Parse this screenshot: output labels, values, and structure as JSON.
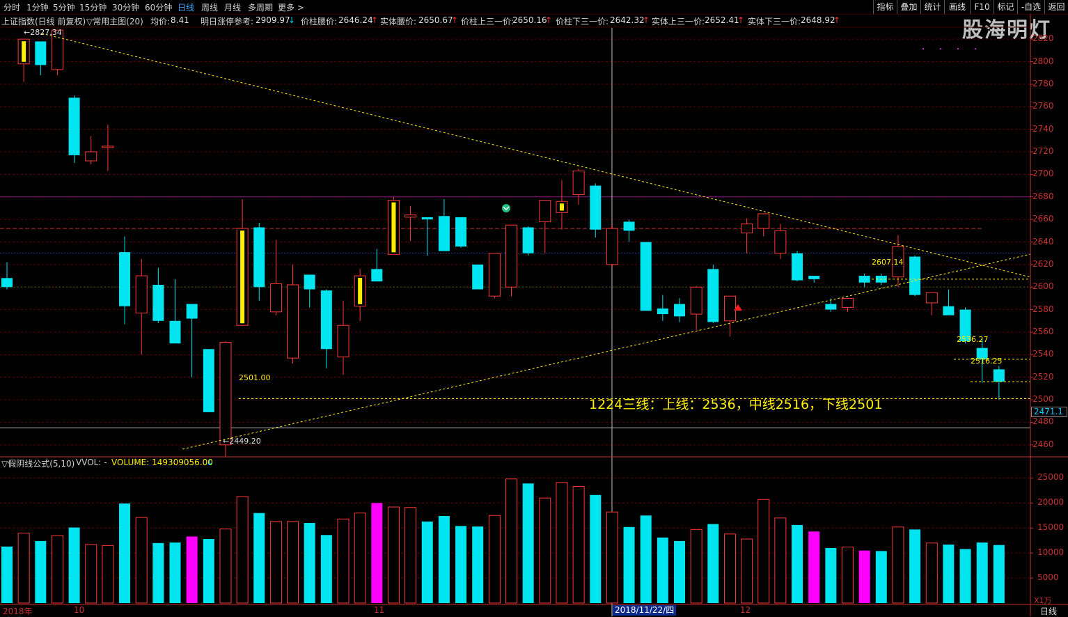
{
  "toolbar": {
    "periods": [
      "分时",
      "1分钟",
      "5分钟",
      "15分钟",
      "30分钟",
      "60分钟",
      "日线",
      "周线",
      "月线",
      "多周期",
      "更多 >"
    ],
    "active_period": "日线",
    "right_tools": [
      "指标",
      "叠加",
      "统计",
      "画线",
      "F10",
      "标记",
      "-自选",
      "返回"
    ]
  },
  "info": {
    "index_name": "上证指数(日线 前复权)",
    "main_chart": "▽常用主图(20)",
    "avg_label": "均价:",
    "avg_value": "8.41",
    "limit_label": "明日涨停参考:",
    "limit_value": "2909.97",
    "limit_arrow": "↓",
    "waist_label": "价柱腰价:",
    "waist_value": "2646.24",
    "waist_arrow": "↑",
    "body_waist_label": "实体腰价:",
    "body_waist_value": "2650.67",
    "body_waist_arrow": "↑",
    "upper_third_label": "价柱上三一价:",
    "upper_third_value": "2650.16",
    "upper_third_arrow": "↑",
    "lower_third_label": "价柱下三一价:",
    "lower_third_value": "2642.32",
    "lower_third_arrow": "↑",
    "body_upper_label": "实体上三一价:",
    "body_upper_value": "2652.41",
    "body_upper_arrow": "↑",
    "body_lower_label": "实体下三一价:",
    "body_lower_value": "2648.92",
    "body_lower_arrow": "↑"
  },
  "logo": "股海明灯",
  "volume_bar": {
    "indicator": "▽假阴线公式(5,10)",
    "vol_label": "VVOL: -",
    "volume_text": "VOLUME: 149309056.00",
    "volume_arrow": "↓"
  },
  "price_axis": [
    "2820",
    "2800",
    "2780",
    "2760",
    "2740",
    "2720",
    "2700",
    "2680",
    "2660",
    "2640",
    "2620",
    "2600",
    "2580",
    "2560",
    "2540",
    "2520",
    "2500",
    "2480",
    "2460"
  ],
  "current_price": "2471.1",
  "volume_axis": [
    "25000",
    "20000",
    "15000",
    "10000",
    "5000"
  ],
  "volume_unit": "X1万",
  "dates": {
    "year": "2018年",
    "m10": "10",
    "m11": "11",
    "m12": "12",
    "selected": "2018/11/22/四"
  },
  "bottom_right_period": "日线",
  "annotations": {
    "high": "2827.34",
    "low": "2449.20",
    "level_2501": "2501.00",
    "level_2607": "2607.14",
    "level_2536": "2536.27",
    "level_2516": "2516.25",
    "note": "1224三线：上线：2536，中线2516，下线2501"
  },
  "chart_data": {
    "type": "candlestick",
    "price_ylim": [
      2450,
      2830
    ],
    "volume_ylim": [
      0,
      27000
    ],
    "candles": [
      {
        "o": 2608,
        "h": 2622,
        "l": 2598,
        "c": 2600,
        "v": 11300,
        "t": "down"
      },
      {
        "o": 2798,
        "h": 2812,
        "l": 2782,
        "c": 2820,
        "v": 14000,
        "t": "up"
      },
      {
        "o": 2797,
        "h": 2812,
        "l": 2788,
        "c": 2818,
        "v": 12400,
        "t": "down"
      },
      {
        "o": 2793,
        "h": 2827,
        "l": 2788,
        "c": 2828,
        "v": 13500,
        "t": "up"
      },
      {
        "o": 2768,
        "h": 2770,
        "l": 2710,
        "c": 2717,
        "v": 15100,
        "t": "down"
      },
      {
        "o": 2712,
        "h": 2734,
        "l": 2709,
        "c": 2720,
        "v": 11700,
        "t": "up"
      },
      {
        "o": 2724,
        "h": 2744,
        "l": 2703,
        "c": 2725,
        "v": 11500,
        "t": "up"
      },
      {
        "o": 2631,
        "h": 2645,
        "l": 2567,
        "c": 2583,
        "v": 19900,
        "t": "down"
      },
      {
        "o": 2577,
        "h": 2625,
        "l": 2540,
        "c": 2610,
        "v": 17100,
        "t": "up"
      },
      {
        "o": 2602,
        "h": 2617,
        "l": 2568,
        "c": 2570,
        "v": 12000,
        "t": "down"
      },
      {
        "o": 2570,
        "h": 2607,
        "l": 2560,
        "c": 2550,
        "v": 12100,
        "t": "down"
      },
      {
        "o": 2572,
        "h": 2580,
        "l": 2520,
        "c": 2585,
        "v": 13300,
        "t": "down"
      },
      {
        "o": 2545,
        "h": 2545,
        "l": 2489,
        "c": 2489,
        "v": 12800,
        "t": "down"
      },
      {
        "o": 2460,
        "h": 2552,
        "l": 2449,
        "c": 2551,
        "v": 14800,
        "t": "up"
      },
      {
        "o": 2566,
        "h": 2678,
        "l": 2566,
        "c": 2652,
        "v": 21300,
        "t": "up"
      },
      {
        "o": 2653,
        "h": 2657,
        "l": 2588,
        "c": 2600,
        "v": 18000,
        "t": "down"
      },
      {
        "o": 2578,
        "h": 2642,
        "l": 2575,
        "c": 2603,
        "v": 16300,
        "t": "up"
      },
      {
        "o": 2537,
        "h": 2620,
        "l": 2532,
        "c": 2602,
        "v": 16300,
        "t": "up"
      },
      {
        "o": 2598,
        "h": 2610,
        "l": 2582,
        "c": 2611,
        "v": 16000,
        "t": "down"
      },
      {
        "o": 2597,
        "h": 2598,
        "l": 2528,
        "c": 2545,
        "v": 13600,
        "t": "down"
      },
      {
        "o": 2538,
        "h": 2588,
        "l": 2522,
        "c": 2566,
        "v": 16800,
        "t": "up"
      },
      {
        "o": 2583,
        "h": 2616,
        "l": 2570,
        "c": 2610,
        "v": 18000,
        "t": "up"
      },
      {
        "o": 2605,
        "h": 2634,
        "l": 2605,
        "c": 2616,
        "v": 20000,
        "t": "down"
      },
      {
        "o": 2629,
        "h": 2680,
        "l": 2629,
        "c": 2677,
        "v": 19200,
        "t": "up"
      },
      {
        "o": 2662,
        "h": 2672,
        "l": 2641,
        "c": 2664,
        "v": 19100,
        "t": "up"
      },
      {
        "o": 2662,
        "h": 2662,
        "l": 2628,
        "c": 2660,
        "v": 16300,
        "t": "down"
      },
      {
        "o": 2663,
        "h": 2678,
        "l": 2635,
        "c": 2632,
        "v": 17400,
        "t": "down"
      },
      {
        "o": 2662,
        "h": 2662,
        "l": 2635,
        "c": 2636,
        "v": 15400,
        "t": "down"
      },
      {
        "o": 2620,
        "h": 2620,
        "l": 2598,
        "c": 2598,
        "v": 15300,
        "t": "down"
      },
      {
        "o": 2592,
        "h": 2630,
        "l": 2590,
        "c": 2630,
        "v": 17500,
        "t": "up"
      },
      {
        "o": 2600,
        "h": 2620,
        "l": 2592,
        "c": 2655,
        "v": 24800,
        "t": "up"
      },
      {
        "o": 2653,
        "h": 2654,
        "l": 2628,
        "c": 2630,
        "v": 23900,
        "t": "down"
      },
      {
        "o": 2658,
        "h": 2669,
        "l": 2630,
        "c": 2677,
        "v": 21000,
        "t": "up"
      },
      {
        "o": 2676,
        "h": 2695,
        "l": 2651,
        "c": 2666,
        "v": 24100,
        "t": "up"
      },
      {
        "o": 2703,
        "h": 2705,
        "l": 2673,
        "c": 2682,
        "v": 23300,
        "t": "up"
      },
      {
        "o": 2690,
        "h": 2692,
        "l": 2644,
        "c": 2651,
        "v": 21600,
        "t": "down"
      },
      {
        "o": 2620,
        "h": 2655,
        "l": 2618,
        "c": 2652,
        "v": 18200,
        "t": "up"
      },
      {
        "o": 2658,
        "h": 2660,
        "l": 2640,
        "c": 2650,
        "v": 15200,
        "t": "down"
      },
      {
        "o": 2640,
        "h": 2640,
        "l": 2579,
        "c": 2579,
        "v": 17500,
        "t": "down"
      },
      {
        "o": 2581,
        "h": 2593,
        "l": 2570,
        "c": 2576,
        "v": 13100,
        "t": "down"
      },
      {
        "o": 2585,
        "h": 2590,
        "l": 2569,
        "c": 2574,
        "v": 12400,
        "t": "down"
      },
      {
        "o": 2576,
        "h": 2601,
        "l": 2562,
        "c": 2600,
        "v": 14700,
        "t": "up"
      },
      {
        "o": 2616,
        "h": 2620,
        "l": 2568,
        "c": 2569,
        "v": 15800,
        "t": "down"
      },
      {
        "o": 2570,
        "h": 2590,
        "l": 2556,
        "c": 2592,
        "v": 13800,
        "t": "up"
      },
      {
        "o": 2648,
        "h": 2661,
        "l": 2630,
        "c": 2656,
        "v": 12800,
        "t": "up"
      },
      {
        "o": 2652,
        "h": 2665,
        "l": 2645,
        "c": 2665,
        "v": 20700,
        "t": "up"
      },
      {
        "o": 2630,
        "h": 2656,
        "l": 2625,
        "c": 2650,
        "v": 17000,
        "t": "up"
      },
      {
        "o": 2630,
        "h": 2632,
        "l": 2605,
        "c": 2606,
        "v": 15600,
        "t": "down"
      },
      {
        "o": 2610,
        "h": 2608,
        "l": 2604,
        "c": 2607,
        "v": 14300,
        "t": "down"
      },
      {
        "o": 2585,
        "h": 2590,
        "l": 2578,
        "c": 2580,
        "v": 11000,
        "t": "down"
      },
      {
        "o": 2582,
        "h": 2590,
        "l": 2578,
        "c": 2590,
        "v": 11200,
        "t": "up"
      },
      {
        "o": 2604,
        "h": 2612,
        "l": 2600,
        "c": 2610,
        "v": 10500,
        "t": "down"
      },
      {
        "o": 2610,
        "h": 2612,
        "l": 2602,
        "c": 2604,
        "v": 10400,
        "t": "down"
      },
      {
        "o": 2636,
        "h": 2646,
        "l": 2600,
        "c": 2609,
        "v": 15200,
        "t": "up"
      },
      {
        "o": 2627,
        "h": 2628,
        "l": 2592,
        "c": 2593,
        "v": 14700,
        "t": "down"
      },
      {
        "o": 2586,
        "h": 2595,
        "l": 2575,
        "c": 2595,
        "v": 12000,
        "t": "up"
      },
      {
        "o": 2583,
        "h": 2598,
        "l": 2575,
        "c": 2575,
        "v": 11700,
        "t": "down"
      },
      {
        "o": 2580,
        "h": 2582,
        "l": 2550,
        "c": 2552,
        "v": 10800,
        "t": "down"
      },
      {
        "o": 2546,
        "h": 2555,
        "l": 2515,
        "c": 2536,
        "v": 12100,
        "t": "down"
      },
      {
        "o": 2527,
        "h": 2530,
        "l": 2500,
        "c": 2516,
        "v": 11600,
        "t": "down"
      }
    ]
  },
  "colors": {
    "up": "#ff3838",
    "down": "#00e5f0",
    "flat_mid": "#ffee00",
    "magenta": "#ff00ff",
    "grid": "#5a0000",
    "axis": "#c83030",
    "trend": "#ffee00",
    "crosshair": "#c0c0c0"
  }
}
